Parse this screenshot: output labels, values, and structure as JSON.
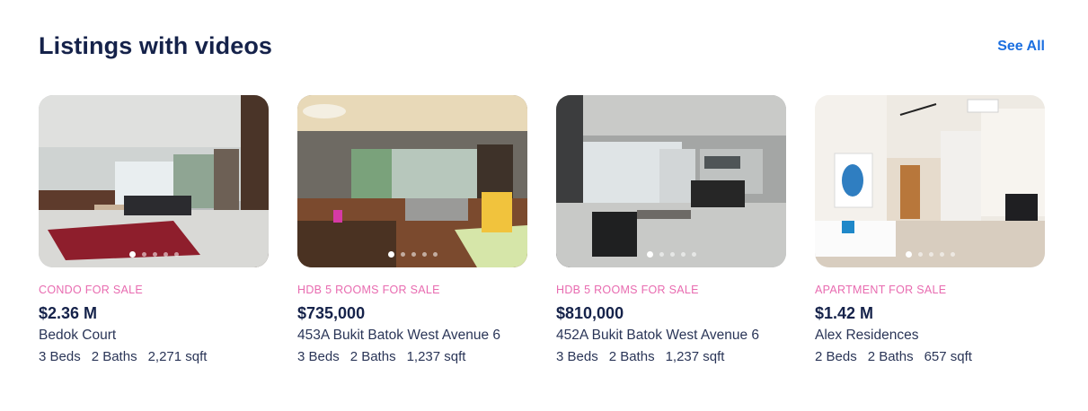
{
  "section": {
    "title": "Listings with videos",
    "see_all_label": "See All"
  },
  "listings": [
    {
      "type": "CONDO FOR SALE",
      "price": "$2.36 M",
      "name": "Bedok Court",
      "beds": "3 Beds",
      "baths": "2 Baths",
      "area": "2,271 sqft",
      "photo_count_dots": 5,
      "active_photo": 1
    },
    {
      "type": "HDB 5 ROOMS FOR SALE",
      "price": "$735,000",
      "name": "453A Bukit Batok West Avenue 6",
      "beds": "3 Beds",
      "baths": "2 Baths",
      "area": "1,237 sqft",
      "photo_count_dots": 5,
      "active_photo": 1
    },
    {
      "type": "HDB 5 ROOMS FOR SALE",
      "price": "$810,000",
      "name": "452A Bukit Batok West Avenue 6",
      "beds": "3 Beds",
      "baths": "2 Baths",
      "area": "1,237 sqft",
      "photo_count_dots": 5,
      "active_photo": 1
    },
    {
      "type": "APARTMENT FOR SALE",
      "price": "$1.42 M",
      "name": "Alex Residences",
      "beds": "2 Beds",
      "baths": "2 Baths",
      "area": "657 sqft",
      "photo_count_dots": 5,
      "active_photo": 1
    }
  ],
  "colors": {
    "title": "#15224a",
    "link": "#1b6fe0",
    "listing_type": "#e86bb0"
  }
}
